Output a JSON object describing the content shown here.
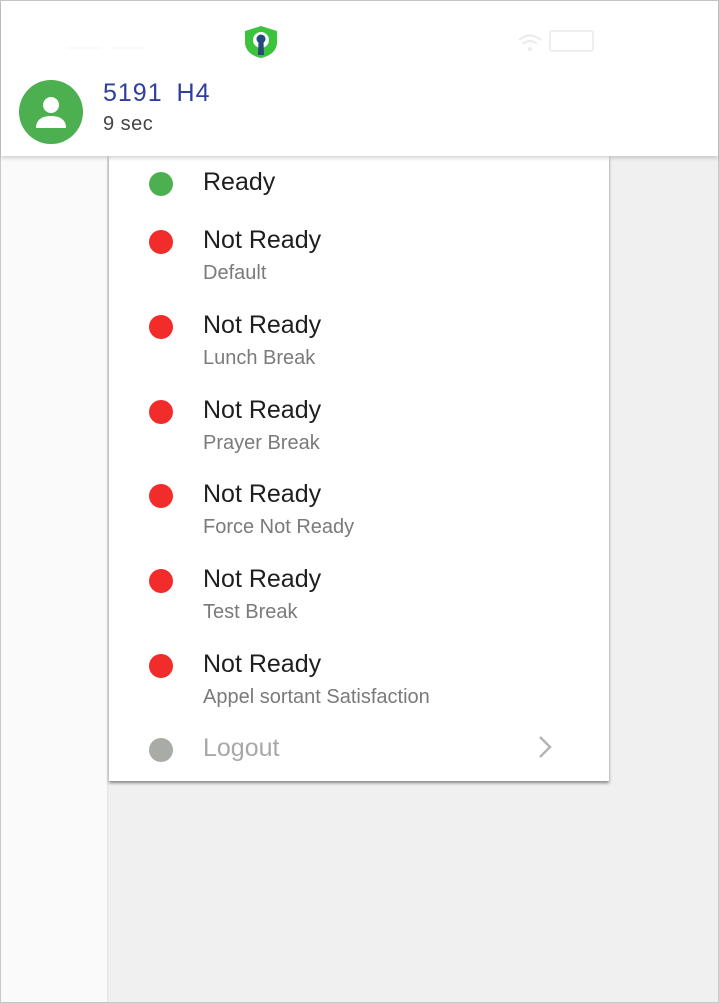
{
  "status_bar": {
    "icons": [
      "signal-icon",
      "vpn-shield-icon",
      "wifi-icon",
      "battery-icon"
    ]
  },
  "header": {
    "agent_name": "5191  H4",
    "timer": "9 sec",
    "avatar_icon": "person-icon",
    "avatar_color": "#4caf50"
  },
  "menu": {
    "items": [
      {
        "label": "Ready",
        "sub": "",
        "status": "ready",
        "color": "#4caf50"
      },
      {
        "label": "Not Ready",
        "sub": "Default",
        "status": "not-ready",
        "color": "#f22b2b"
      },
      {
        "label": "Not Ready",
        "sub": "Lunch Break",
        "status": "not-ready",
        "color": "#f22b2b"
      },
      {
        "label": "Not Ready",
        "sub": "Prayer Break",
        "status": "not-ready",
        "color": "#f22b2b"
      },
      {
        "label": "Not Ready",
        "sub": "Force Not Ready",
        "status": "not-ready",
        "color": "#f22b2b"
      },
      {
        "label": "Not Ready",
        "sub": "Test Break",
        "status": "not-ready",
        "color": "#f22b2b"
      },
      {
        "label": "Not Ready",
        "sub": "Appel sortant Satisfaction",
        "status": "not-ready",
        "color": "#f22b2b"
      }
    ],
    "logout": {
      "label": "Logout",
      "color": "#a9aba7",
      "icon": "chevron-right-icon"
    }
  }
}
